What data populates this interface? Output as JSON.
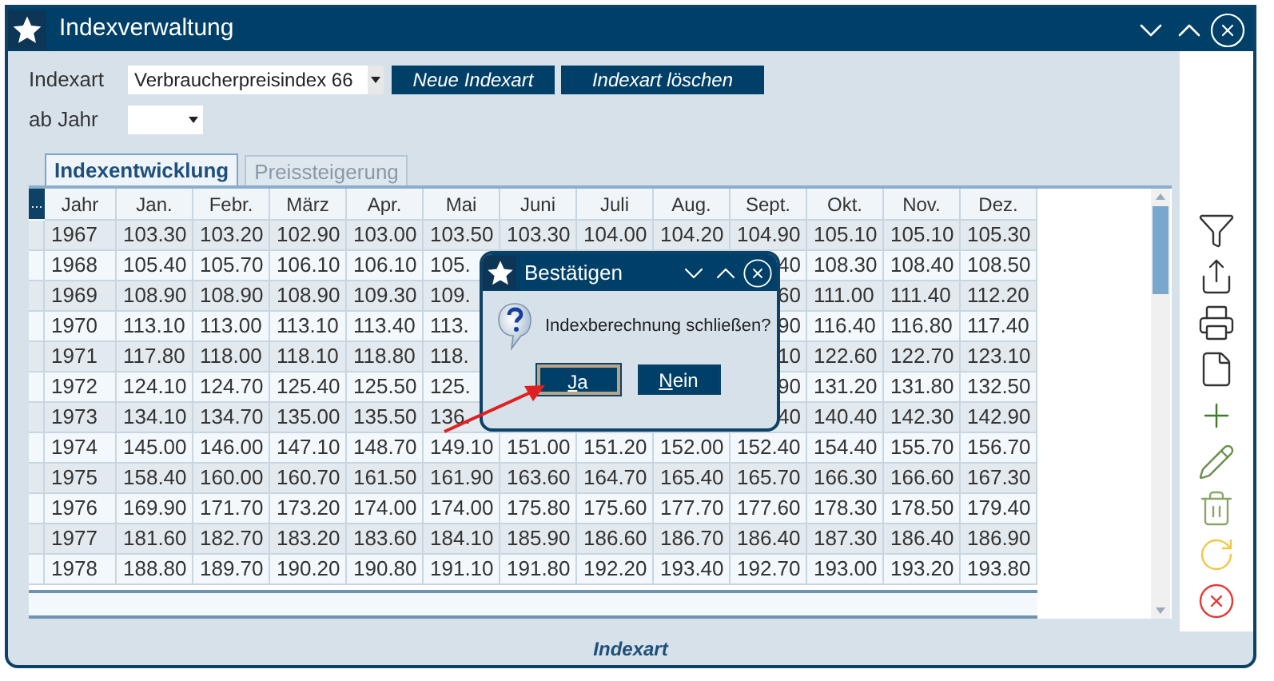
{
  "window": {
    "title": "Indexverwaltung"
  },
  "form": {
    "indexart": {
      "label": "Indexart",
      "value": "Verbraucherpreisindex 66"
    },
    "buttons": [
      "Neue Indexart",
      "Indexart löschen"
    ],
    "ab_jahr": {
      "label": "ab Jahr"
    }
  },
  "tabs": [
    {
      "label": "Indexentwicklung",
      "selected": true
    },
    {
      "label": "Preissteigerung",
      "selected": false
    }
  ],
  "table": {
    "column_chooser": "...",
    "columns": [
      "Jahr",
      "Jan.",
      "Febr.",
      "März",
      "Apr.",
      "Mai",
      "Juni",
      "Juli",
      "Aug.",
      "Sept.",
      "Okt.",
      "Nov.",
      "Dez."
    ],
    "rows": [
      {
        "cells": [
          "1967",
          "103.30",
          "103.20",
          "102.90",
          "103.00",
          "103.50",
          "103.30",
          "104.00",
          "104.20",
          "104.90",
          "105.10",
          "105.10",
          "105.30"
        ]
      },
      {
        "cells": [
          "1968",
          "105.40",
          "105.70",
          "106.10",
          "106.10",
          "105.",
          null,
          null,
          null,
          {
            "text": "40",
            "cut_left": true
          },
          "108.30",
          "108.40",
          "108.50"
        ]
      },
      {
        "cells": [
          "1969",
          "108.90",
          "108.90",
          "108.90",
          "109.30",
          "109.",
          null,
          null,
          null,
          {
            "text": "60",
            "cut_left": true
          },
          "111.00",
          "111.40",
          "112.20"
        ]
      },
      {
        "cells": [
          "1970",
          "113.10",
          "113.00",
          "113.10",
          "113.40",
          "113.",
          null,
          null,
          null,
          {
            "text": "90",
            "cut_left": true
          },
          "116.40",
          "116.80",
          "117.40"
        ]
      },
      {
        "cells": [
          "1971",
          "117.80",
          "118.00",
          "118.10",
          "118.80",
          "118.",
          null,
          null,
          null,
          {
            "text": "10",
            "cut_left": true
          },
          "122.60",
          "122.70",
          "123.10"
        ]
      },
      {
        "cells": [
          "1972",
          "124.10",
          "124.70",
          "125.40",
          "125.50",
          "125.",
          null,
          null,
          null,
          {
            "text": "90",
            "cut_left": true
          },
          "131.20",
          "131.80",
          "132.50"
        ]
      },
      {
        "cells": [
          "1973",
          "134.10",
          "134.70",
          "135.00",
          "135.50",
          "136.",
          null,
          null,
          null,
          {
            "text": "40",
            "cut_left": true
          },
          "140.40",
          "142.30",
          "142.90"
        ]
      },
      {
        "cells": [
          "1974",
          "145.00",
          "146.00",
          "147.10",
          "148.70",
          "149.10",
          "151.00",
          "151.20",
          "152.00",
          "152.40",
          "154.40",
          "155.70",
          "156.70"
        ]
      },
      {
        "cells": [
          "1975",
          "158.40",
          "160.00",
          "160.70",
          "161.50",
          "161.90",
          "163.60",
          "164.70",
          "165.40",
          "165.70",
          "166.30",
          "166.60",
          "167.30"
        ]
      },
      {
        "cells": [
          "1976",
          "169.90",
          "171.70",
          "173.20",
          "174.00",
          "174.00",
          "175.80",
          "175.60",
          "177.70",
          "177.60",
          "178.30",
          "178.50",
          "179.40"
        ]
      },
      {
        "cells": [
          "1977",
          "181.60",
          "182.70",
          "183.20",
          "183.60",
          "184.10",
          "185.90",
          "186.60",
          "186.70",
          "186.40",
          "187.30",
          "186.40",
          "186.90"
        ]
      },
      {
        "cells": [
          "1978",
          "188.80",
          "189.70",
          "190.20",
          "190.80",
          "191.10",
          "191.80",
          "192.20",
          "193.40",
          "192.70",
          "193.00",
          "193.20",
          "193.80"
        ]
      }
    ]
  },
  "footer": {
    "label": "Indexart"
  },
  "dialog": {
    "title": "Bestätigen",
    "message": "Indexberechnung schließen?",
    "buttons": [
      {
        "label": "Ja",
        "selected": true
      },
      {
        "label": "Nein",
        "selected": false
      }
    ]
  }
}
